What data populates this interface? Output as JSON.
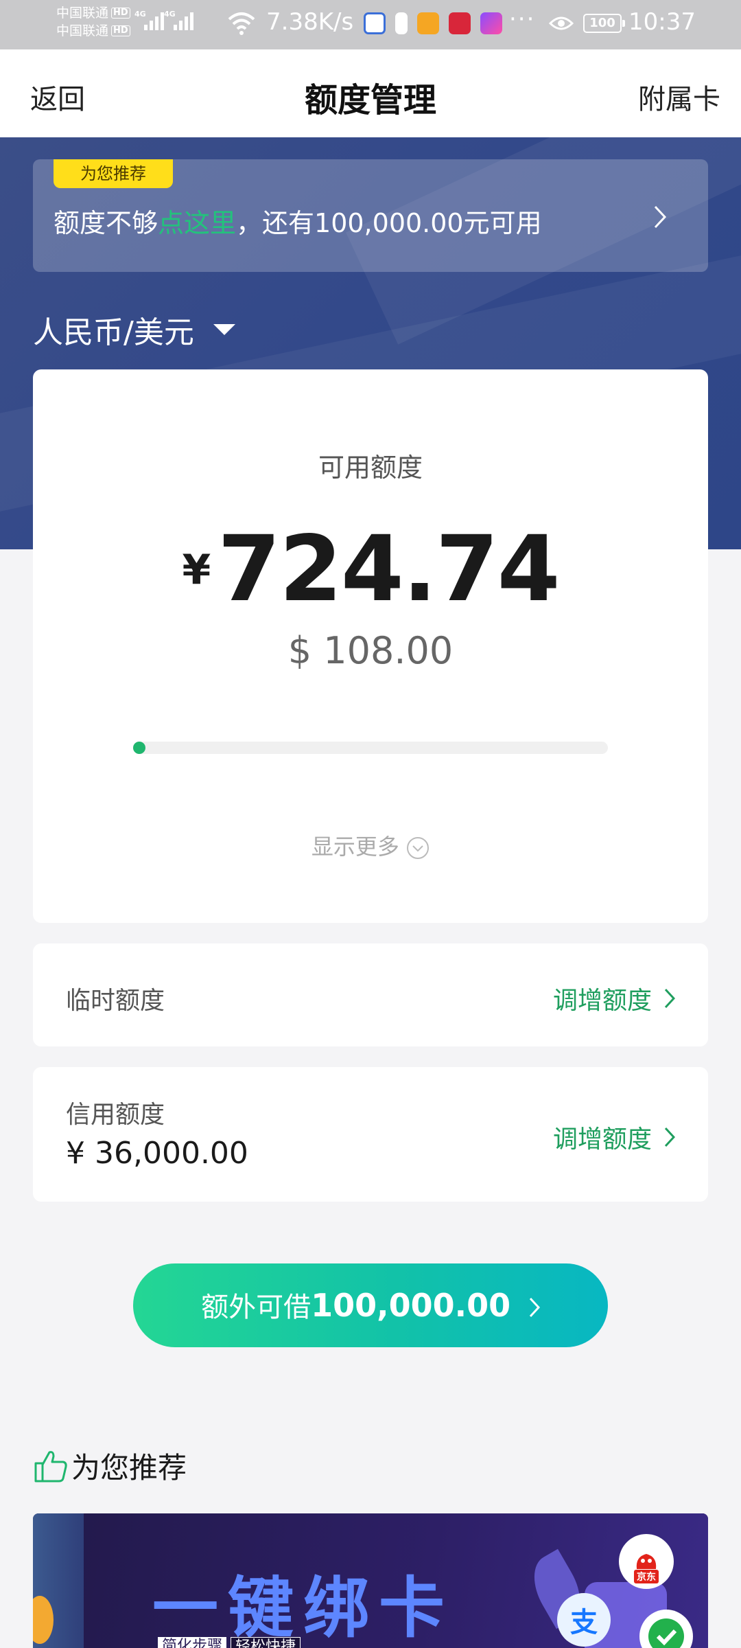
{
  "status_bar": {
    "carrier1": "中国联通",
    "carrier2": "中国联通",
    "hd": "HD",
    "net": "4G",
    "speed": "7.38K/s",
    "dots": "···",
    "battery": "100",
    "time": "10:37"
  },
  "nav": {
    "back": "返回",
    "title": "额度管理",
    "right": "附属卡"
  },
  "promo": {
    "badge": "为您推荐",
    "text_prefix": "额度不够",
    "text_highlight": "点这里",
    "text_suffix": "，还有100,000.00元可用"
  },
  "currency_selector": "人民币/美元",
  "card": {
    "label": "可用额度",
    "cny_symbol": "¥",
    "cny_amount": "724.74",
    "usd_amount": "$ 108.00",
    "usage_fraction": 0.02,
    "show_more": "显示更多"
  },
  "temp_limit": {
    "label": "临时额度",
    "action": "调增额度"
  },
  "credit_limit": {
    "label": "信用额度",
    "value": "¥ 36,000.00",
    "action": "调增额度"
  },
  "cta": {
    "prefix": "额外可借",
    "amount": "100,000.00"
  },
  "recommend": {
    "title": "为您推荐",
    "banner_title": "一键绑卡",
    "banner_tag1": "简化步骤",
    "banner_tag2": "轻松快捷",
    "jd_label": "京东",
    "alipay_glyph": "支"
  },
  "colors": {
    "accent_green": "#1f9e5e",
    "hero_blue": "#33498a",
    "badge_yellow": "#ffde1a"
  }
}
